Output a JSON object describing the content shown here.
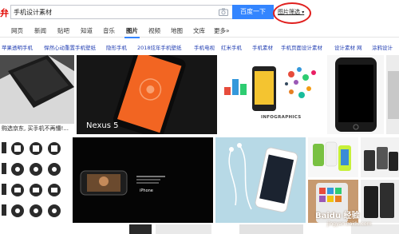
{
  "search": {
    "logo_fragment": "弁",
    "query": "手机设计素材",
    "button_label": "百度一下",
    "filter_label": "图片筛选"
  },
  "nav": {
    "tabs": [
      "网页",
      "新闻",
      "贴吧",
      "知道",
      "音乐",
      "图片",
      "视频",
      "地图",
      "文库",
      "更多»"
    ],
    "active_tab": "图片"
  },
  "related_tags": [
    "苹果透明手机",
    "悍然心动重置手机壁纸",
    "隐形手机",
    "2018炫年手机壁纸",
    "手机电视",
    "红米手机",
    "手机素材",
    "手机页面设计素材",
    "设计素材 网",
    "涂鸦设计"
  ],
  "results": {
    "caption_1": "购选京东, 买手机不再懵!...",
    "nexus_text": "Nexus 5",
    "infographics_text": "INFOGRAPHICS",
    "iphone_text": "iPhone"
  },
  "watermark": {
    "main": "Baidu 经验",
    "sub": "jingyan.baidu.com"
  },
  "colors": {
    "brand_red": "#e10601",
    "button_blue": "#3385ff",
    "tag_link": "#2440b3",
    "highlight_circle": "#e0201f"
  },
  "icons": [
    "camera-icon",
    "chevron-down-icon"
  ]
}
